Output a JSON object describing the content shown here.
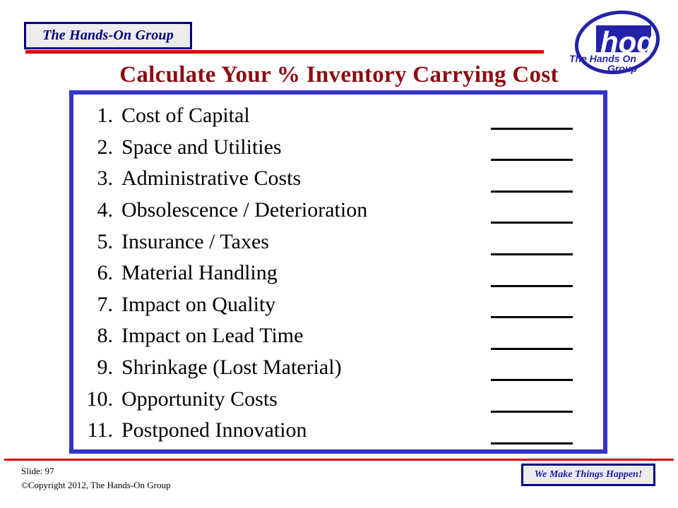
{
  "slide": {
    "title": "Calculate Your % Inventory Carrying Cost",
    "title_color": "#8c0b11",
    "box_border_color": "#3333cc",
    "accent_red": "#e00000",
    "accent_navy": "#000080"
  },
  "header": {
    "brand_box_label": "The Hands-On Group",
    "logo": {
      "mark_text": "hog",
      "tagline_line1": "The Hands On",
      "tagline_line2": "Group",
      "mark_color": "#2222aa",
      "mark_text_color": "#ffffff"
    }
  },
  "content": {
    "items": [
      {
        "num": "1.",
        "label": "Cost of Capital"
      },
      {
        "num": "2.",
        "label": "Space and Utilities"
      },
      {
        "num": "3.",
        "label": "Administrative Costs"
      },
      {
        "num": "4.",
        "label": "Obsolescence / Deterioration"
      },
      {
        "num": "5.",
        "label": "Insurance / Taxes"
      },
      {
        "num": "6.",
        "label": "Material Handling"
      },
      {
        "num": "7.",
        "label": "Impact on Quality"
      },
      {
        "num": "8.",
        "label": "Impact on Lead Time"
      },
      {
        "num": "9.",
        "label": "Shrinkage (Lost Material)"
      },
      {
        "num": "10.",
        "label": "Opportunity Costs"
      },
      {
        "num": "11.",
        "label": "Postponed Innovation"
      }
    ],
    "blank_values": [
      "",
      "",
      "",
      "",
      "",
      "",
      "",
      "",
      "",
      "",
      ""
    ]
  },
  "footer": {
    "slide_label": "Slide:   97",
    "copyright": "©Copyright 2012, The Hands-On Group",
    "tagline": "We Make Things Happen!"
  }
}
